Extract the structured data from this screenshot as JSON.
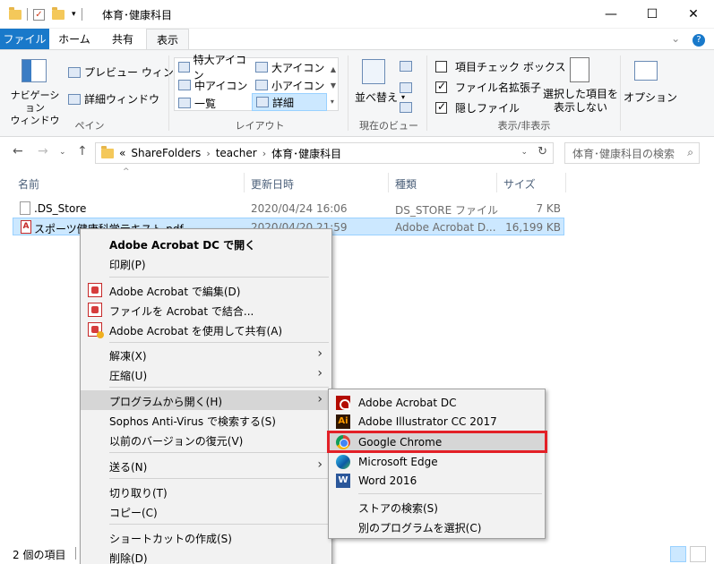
{
  "window": {
    "title": "体育･健康科目",
    "minimize": "—",
    "maximize": "☐",
    "close": "✕"
  },
  "ribbon_tabs": [
    {
      "label": "ファイル"
    },
    {
      "label": "ホーム"
    },
    {
      "label": "共有"
    },
    {
      "label": "表示"
    }
  ],
  "ribbon": {
    "pane_group": {
      "nav_pane": "ナビゲーション\nウィンドウ",
      "preview": "プレビュー ウィンドウ",
      "details": "詳細ウィンドウ",
      "label": "ペイン"
    },
    "layout_group": {
      "items": [
        "特大アイコン",
        "大アイコン",
        "中アイコン",
        "小アイコン",
        "一覧",
        "詳細"
      ],
      "label": "レイアウト"
    },
    "current_view": {
      "sort": "並べ替え",
      "label": "現在のビュー"
    },
    "showhide": {
      "item_check": "項目チェック ボックス",
      "extensions": "ファイル名拡張子",
      "hidden": "隠しファイル",
      "hide_selected": "選択した項目を\n表示しない",
      "label": "表示/非表示"
    },
    "options": "オプション"
  },
  "address": {
    "path": [
      "«",
      "ShareFolders",
      "teacher",
      "体育･健康科目"
    ],
    "search_placeholder": "体育･健康科目の検索"
  },
  "columns": [
    "名前",
    "更新日時",
    "種類",
    "サイズ"
  ],
  "files": [
    {
      "name": ".DS_Store",
      "date": "2020/04/24 16:06",
      "type": "DS_STORE ファイル",
      "size": "7 KB"
    },
    {
      "name": "スポーツ健康科学テキスト.pdf",
      "date": "2020/04/20 21:59",
      "type": "Adobe Acrobat D...",
      "size": "16,199 KB"
    }
  ],
  "status": {
    "count": "2 個の項目"
  },
  "context_menu": [
    {
      "label": "Adobe Acrobat DC で開く"
    },
    {
      "label": "印刷(P)"
    },
    {
      "label": "Adobe Acrobat で編集(D)"
    },
    {
      "label": "ファイルを Acrobat で結合..."
    },
    {
      "label": "Adobe Acrobat を使用して共有(A)"
    },
    {
      "label": "解凍(X)"
    },
    {
      "label": "圧縮(U)"
    },
    {
      "label": "プログラムから開く(H)"
    },
    {
      "label": "Sophos Anti-Virus で検索する(S)"
    },
    {
      "label": "以前のバージョンの復元(V)"
    },
    {
      "label": "送る(N)"
    },
    {
      "label": "切り取り(T)"
    },
    {
      "label": "コピー(C)"
    },
    {
      "label": "ショートカットの作成(S)"
    },
    {
      "label": "削除(D)"
    }
  ],
  "open_with": [
    {
      "label": "Adobe Acrobat DC"
    },
    {
      "label": "Adobe Illustrator CC 2017"
    },
    {
      "label": "Google Chrome"
    },
    {
      "label": "Microsoft Edge"
    },
    {
      "label": "Word 2016"
    },
    {
      "label": "ストアの検索(S)"
    },
    {
      "label": "別のプログラムを選択(C)"
    }
  ],
  "icons": {
    "ai": "Ai",
    "word": "W",
    "pdf": "A"
  },
  "colors": {
    "accent": "#1979ca",
    "selection": "#cce8ff",
    "highlight_box": "#e32027"
  }
}
